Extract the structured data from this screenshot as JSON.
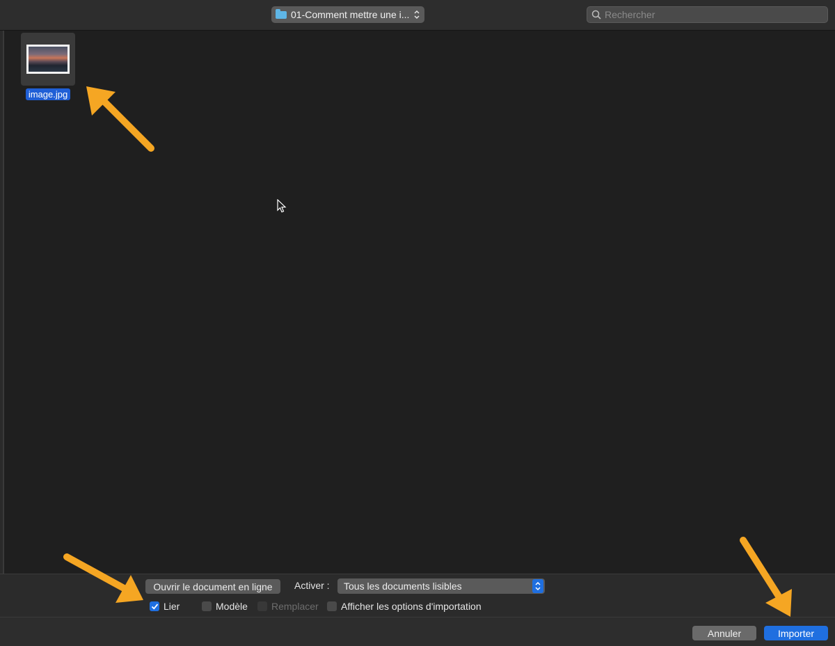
{
  "toolbar": {
    "path_label": "01-Comment mettre une i...",
    "search_placeholder": "Rechercher"
  },
  "browser": {
    "files": [
      {
        "name": "image.jpg",
        "selected": true
      }
    ]
  },
  "options": {
    "open_online_label": "Ouvrir le document en ligne",
    "activer_label": "Activer :",
    "activer_selected": "Tous les documents lisibles",
    "checkboxes": [
      {
        "label": "Lier",
        "checked": true,
        "enabled": true
      },
      {
        "label": "Modèle",
        "checked": false,
        "enabled": true
      },
      {
        "label": "Remplacer",
        "checked": false,
        "enabled": false
      },
      {
        "label": "Afficher les options d'importation",
        "checked": false,
        "enabled": true
      }
    ]
  },
  "footer": {
    "cancel_label": "Annuler",
    "import_label": "Importer"
  },
  "colors": {
    "accent": "#1f6fe0",
    "annotation_arrow": "#f5a623",
    "background": "#1f1f1f"
  },
  "icons": {
    "folder": "folder-icon",
    "search": "search-icon",
    "popup_arrows": "updown-chevron-icon",
    "checkmark": "checkmark-icon",
    "cursor": "mouse-pointer-icon"
  }
}
